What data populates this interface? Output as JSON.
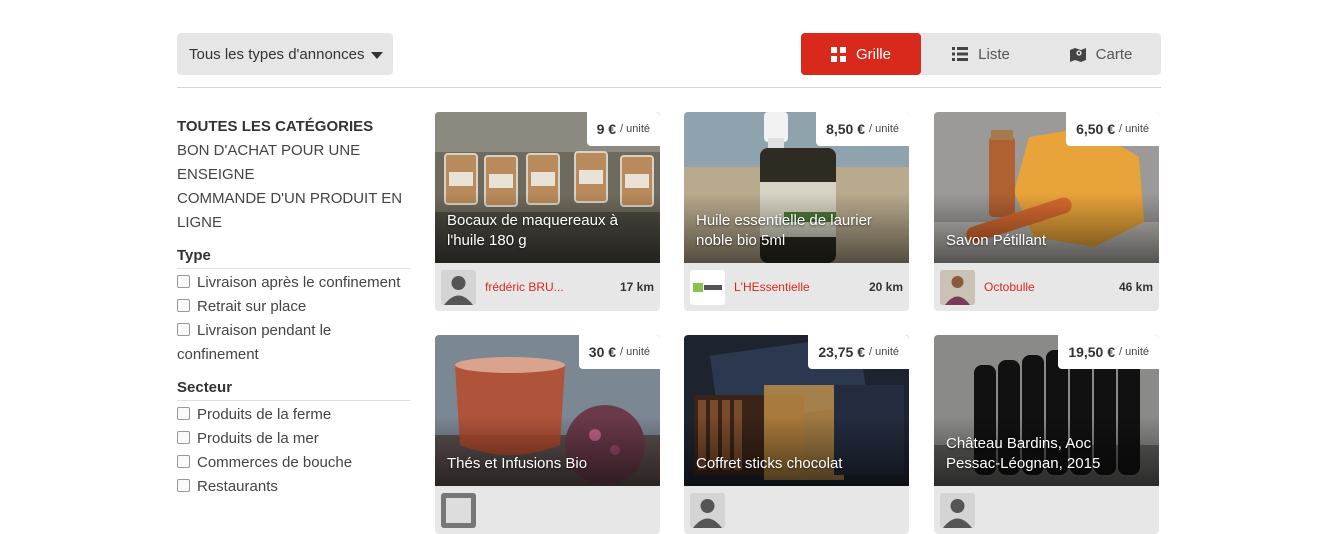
{
  "toolbar": {
    "type_filter_label": "Tous les types d'annonces",
    "views": [
      {
        "label": "Grille",
        "icon": "grid-icon",
        "active": true
      },
      {
        "label": "Liste",
        "icon": "list-icon",
        "active": false
      },
      {
        "label": "Carte",
        "icon": "map-icon",
        "active": false
      }
    ]
  },
  "sidebar": {
    "categories_heading": "TOUTES LES CATÉGORIES",
    "categories": [
      "BON D'ACHAT POUR UNE ENSEIGNE",
      "COMMANDE D'UN PRODUIT EN LIGNE"
    ],
    "type_title": "Type",
    "type_options": [
      "Livraison après le confinement",
      "Retrait sur place",
      "Livraison pendant le confinement"
    ],
    "sector_title": "Secteur",
    "sector_options": [
      "Produits de la ferme",
      "Produits de la mer",
      "Commerces de bouche",
      "Restaurants"
    ]
  },
  "listings": [
    {
      "title": "Bocaux de maquereaux à l'huile 180 g",
      "price": "9 €",
      "unit": "/ unité",
      "seller": "frédéric BRU...",
      "distance": "17 km"
    },
    {
      "title": "Huile essentielle de laurier noble bio 5ml",
      "price": "8,50 €",
      "unit": "/ unité",
      "seller": "L'HEssentielle",
      "distance": "20 km"
    },
    {
      "title": "Savon Pétillant",
      "price": "6,50 €",
      "unit": "/ unité",
      "seller": "Octobulle",
      "distance": "46 km"
    },
    {
      "title": "Thés et Infusions Bio",
      "price": "30 €",
      "unit": "/ unité",
      "seller": "",
      "distance": ""
    },
    {
      "title": "Coffret sticks chocolat",
      "price": "23,75 €",
      "unit": "/ unité",
      "seller": "",
      "distance": ""
    },
    {
      "title": "Château Bardins, Aoc Pessac-Léognan, 2015",
      "price": "19,50 €",
      "unit": "/ unité",
      "seller": "",
      "distance": ""
    }
  ],
  "colors": {
    "accent": "#d9291c",
    "panel": "#e6e6e6"
  }
}
